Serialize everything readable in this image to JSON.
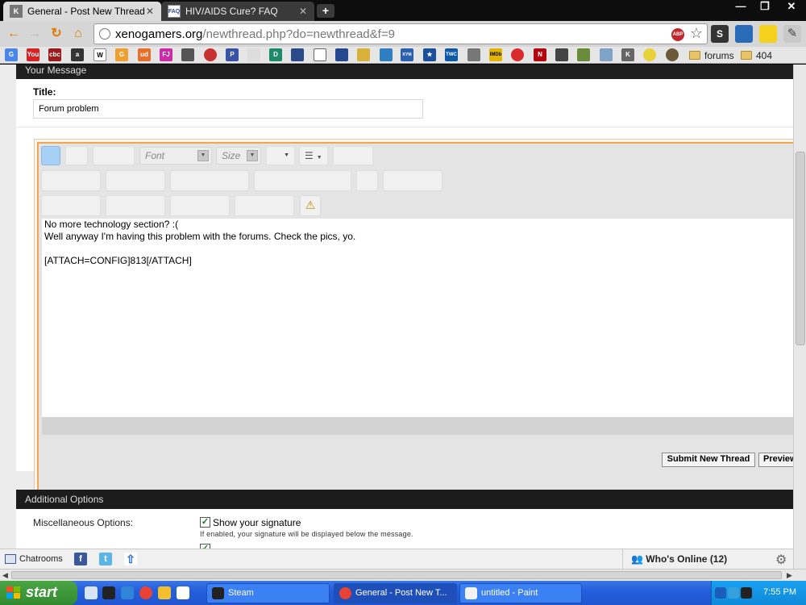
{
  "browser": {
    "tabs": [
      {
        "title": "General - Post New Thread",
        "active": true,
        "favicon": "K"
      },
      {
        "title": "HIV/AIDS Cure? FAQ",
        "active": false,
        "favicon": "FAQ"
      }
    ],
    "new_tab": "+",
    "window_controls": {
      "minimize": "—",
      "restore": "❐",
      "close": "✕"
    },
    "nav": {
      "back": "←",
      "forward": "→",
      "reload": "↻",
      "home": "⌂"
    },
    "url_host": "xenogamers.org",
    "url_path": "/newthread.php?do=newthread&f=9",
    "abp_label": "ABP",
    "star": "☆",
    "bookmark_folders": [
      "forums",
      "404"
    ]
  },
  "page": {
    "panel_header": "Your Message",
    "title_label": "Title:",
    "title_value": "Forum problem",
    "editor": {
      "font_placeholder": "Font",
      "size_placeholder": "Size",
      "dropdown_arrow": "▼",
      "warning_glyph": "⚠",
      "body": "No more technology section? :(\nWell anyway I'm having this problem with the forums. Check the pics, yo.\n\n[ATTACH=CONFIG]813[/ATTACH]"
    },
    "submit_button": "Submit New Thread",
    "preview_button": "Preview",
    "additional_options_header": "Additional Options",
    "misc_label": "Miscellaneous Options:",
    "show_signature_label": "Show your signature",
    "show_signature_checked": true,
    "show_signature_help": "If enabled, your signature will be displayed below the message."
  },
  "chatbar": {
    "chatrooms_label": "Chatrooms",
    "whos_online": "Who's Online (12)",
    "gear": "⚙"
  },
  "taskbar": {
    "start_label": "start",
    "tasks": [
      {
        "label": "Steam",
        "active": false
      },
      {
        "label": "General - Post New T...",
        "active": true
      },
      {
        "label": "untitled - Paint",
        "active": false
      }
    ],
    "clock": "7:55 PM"
  }
}
